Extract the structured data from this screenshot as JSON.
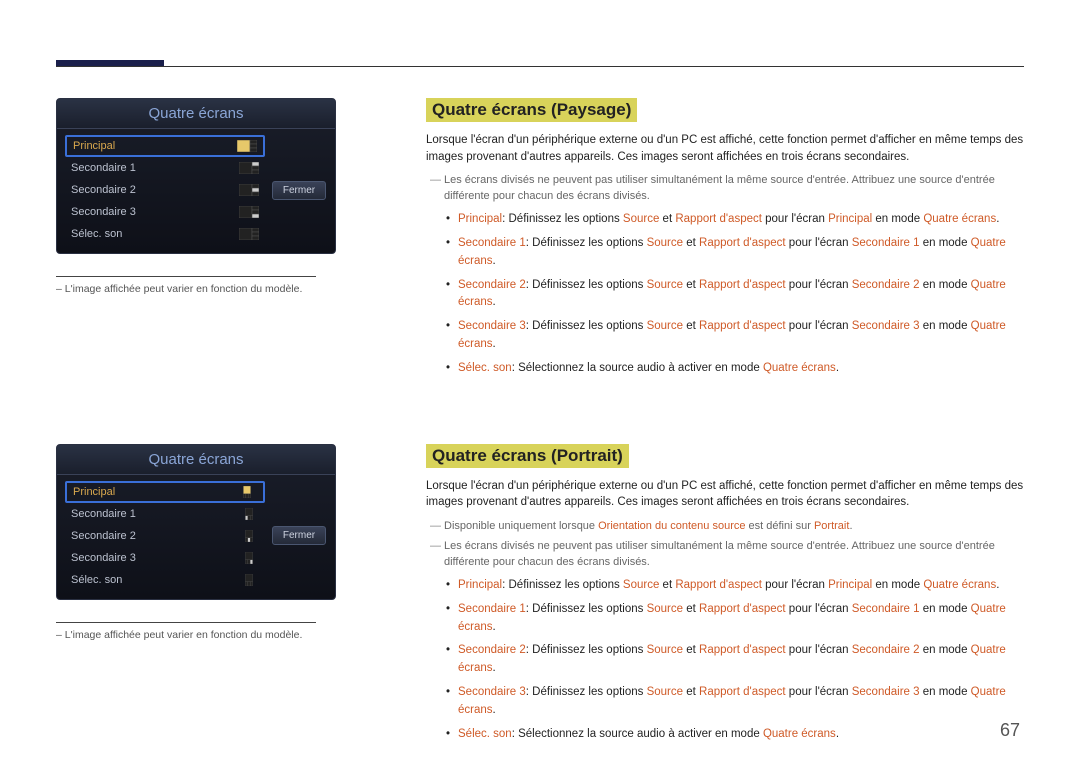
{
  "page_number": "67",
  "paysage": {
    "title": "Quatre écrans (Paysage)",
    "intro": "Lorsque l'écran d'un périphérique externe ou d'un PC est affiché, cette fonction permet d'afficher en même temps des images provenant d'autres appareils. Ces images seront affichées en trois écrans secondaires.",
    "notes": [
      "Les écrans divisés ne peuvent pas utiliser simultanément la même source d'entrée. Attribuez une source d'entrée différente pour chacun des écrans divisés."
    ],
    "bullets": {
      "principal_label": "Principal",
      "principal_pre": ": Définissez les options ",
      "source": "Source",
      "et": " et ",
      "aspect": "Rapport d'aspect",
      "pour": " pour l'écran ",
      "principal_target": "Principal",
      "mode": " en mode ",
      "qe": "Quatre écrans",
      "dot": ".",
      "sec1_label": "Secondaire 1",
      "sec1_target": "Secondaire 1",
      "sec2_label": "Secondaire 2",
      "sec2_target": "Secondaire 2",
      "sec3_label": "Secondaire 3",
      "sec3_target": "Secondaire 3",
      "selec_label": "Sélec. son",
      "selec_text": ": Sélectionnez la source audio à activer en mode "
    },
    "menu": {
      "title": "Quatre écrans",
      "principal": "Principal",
      "sec1": "Secondaire 1",
      "sec2": "Secondaire 2",
      "sec3": "Secondaire 3",
      "selec": "Sélec. son",
      "close": "Fermer"
    },
    "caption": "L'image affichée peut varier en fonction du modèle."
  },
  "portrait": {
    "title": "Quatre écrans (Portrait)",
    "intro": "Lorsque l'écran d'un périphérique externe ou d'un PC est affiché, cette fonction permet d'afficher en même temps des images provenant d'autres appareils. Ces images seront affichées en trois écrans secondaires.",
    "note_avail_pre": "Disponible uniquement lorsque ",
    "note_avail_kw": "Orientation du contenu source",
    "note_avail_mid": " est défini sur ",
    "note_avail_kw2": "Portrait",
    "note_avail_post": ".",
    "notes_shared": "Les écrans divisés ne peuvent pas utiliser simultanément la même source d'entrée. Attribuez une source d'entrée différente pour chacun des écrans divisés.",
    "menu": {
      "title": "Quatre écrans",
      "principal": "Principal",
      "sec1": "Secondaire 1",
      "sec2": "Secondaire 2",
      "sec3": "Secondaire 3",
      "selec": "Sélec. son",
      "close": "Fermer"
    },
    "caption": "L'image affichée peut varier en fonction du modèle."
  }
}
